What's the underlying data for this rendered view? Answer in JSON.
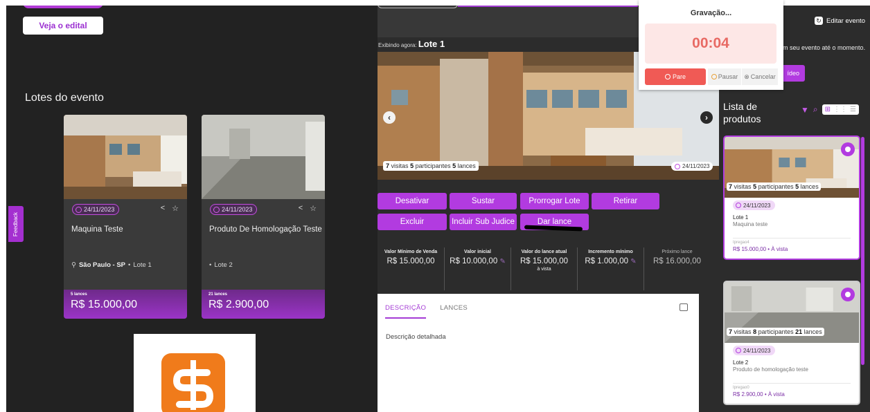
{
  "left": {
    "edital_button": "Veja o edital",
    "section_title": "Lotes do evento",
    "feedback": "Feedback",
    "lots": [
      {
        "date": "24/11/2023",
        "name": "Maquina Teste",
        "location": "São Paulo - SP",
        "lot": "Lote 1",
        "bids": "5 lances",
        "price": "R$ 15.000,00"
      },
      {
        "date": "24/11/2023",
        "name": "Produto De Homologação Teste",
        "location": "",
        "lot": "Lote 2",
        "bids": "21 lances",
        "price": "R$ 2.900,00"
      }
    ]
  },
  "middle": {
    "exibindo_label": "Exibindo agora:",
    "exibindo_value": "Lote 1",
    "visits": {
      "n1": "7",
      "t1": "visitas",
      "n2": "5",
      "t2": "participantes",
      "n3": "5",
      "t3": "lances"
    },
    "gallery_date": "24/11/2023",
    "actions": {
      "desativar": "Desativar",
      "sustar": "Sustar",
      "prorrogar": "Prorrogar Lote",
      "retirar": "Retirar",
      "excluir": "Excluir",
      "sub_judice": "Incluir Sub Judice",
      "dar_lance": "Dar lance"
    },
    "values": [
      {
        "label": "Valor Mínimo de Venda",
        "value": "R$ 15.000,00",
        "sub": ""
      },
      {
        "label": "Valor inicial",
        "value": "R$ 10.000,00",
        "sub": ""
      },
      {
        "label": "Valor do lance atual",
        "value": "R$ 15.000,00",
        "sub": "à vista"
      },
      {
        "label": "Incremento mínimo",
        "value": "R$ 1.000,00",
        "sub": ""
      },
      {
        "label": "Próximo lance",
        "value": "R$ 16.000,00",
        "sub": ""
      }
    ],
    "tabs": {
      "descricao": "DESCRIÇÃO",
      "lances": "LANCES"
    },
    "description": "Descrição detalhada"
  },
  "recording": {
    "title": "Gravação...",
    "timer": "00:04",
    "stop": "Pare",
    "pause": "Pausar",
    "cancel": "Cancelar"
  },
  "right": {
    "edit_event": "Editar evento",
    "partial_text": "m seu evento até o momento.",
    "partial_button": "ídeo",
    "list_title": "Lista de produtos",
    "products": [
      {
        "visits": {
          "n1": "7",
          "t1": "visitas",
          "n2": "5",
          "t2": "participantes",
          "n3": "5",
          "t3": "lances"
        },
        "date": "24/11/2023",
        "lot": "Lote 1",
        "name": "Maquina teste",
        "type": "Ipregao4",
        "price": "R$ 15.000,00 • À vista"
      },
      {
        "visits": {
          "n1": "7",
          "t1": "visitas",
          "n2": "8",
          "t2": "participantes",
          "n3": "21",
          "t3": "lances"
        },
        "date": "24/11/2023",
        "lot": "Lote 2",
        "name": "Produto de homologação teste",
        "type": "Ipregao0",
        "price": "R$ 2.900,00 • À vista"
      }
    ]
  },
  "colors": {
    "accent": "#b23be0",
    "dark_bg": "#222222",
    "panel_bg": "#2c2c2c",
    "timer": "#e86a64",
    "stop": "#f05a55"
  }
}
